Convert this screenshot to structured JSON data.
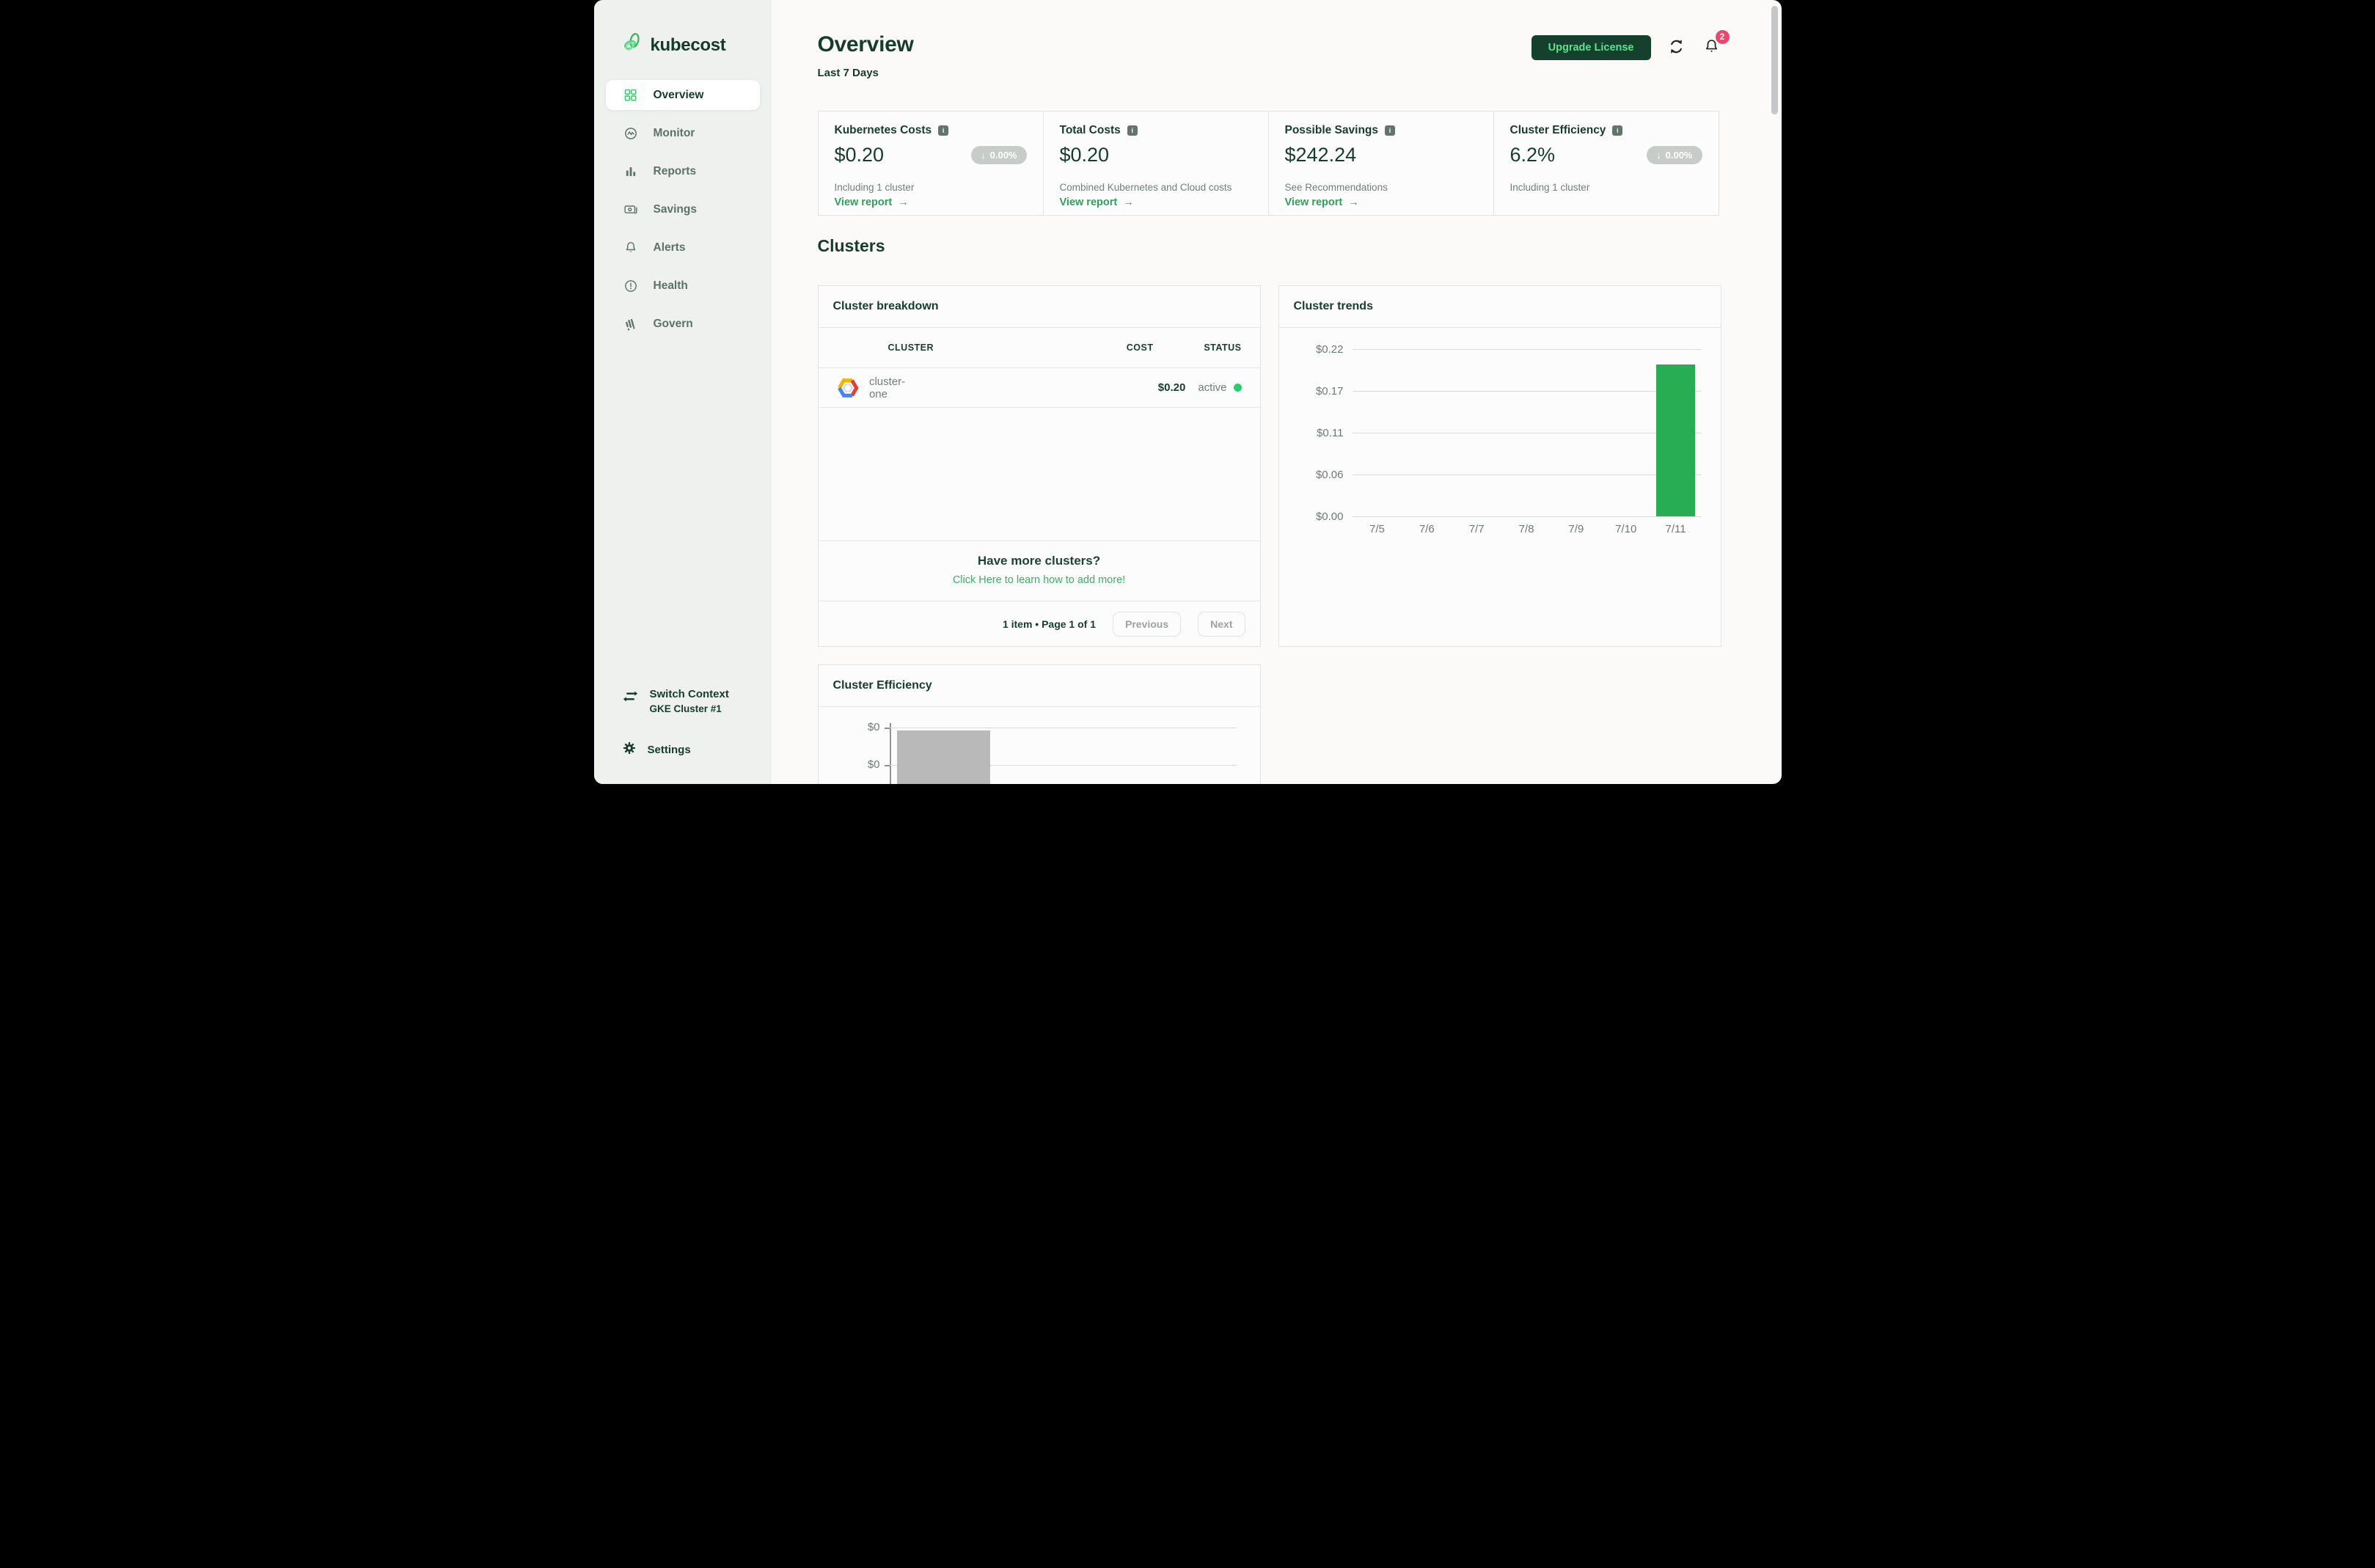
{
  "sidebar": {
    "logo_text": "kubecost",
    "nav": [
      {
        "label": "Overview",
        "active": true
      },
      {
        "label": "Monitor",
        "active": false
      },
      {
        "label": "Reports",
        "active": false
      },
      {
        "label": "Savings",
        "active": false
      },
      {
        "label": "Alerts",
        "active": false
      },
      {
        "label": "Health",
        "active": false
      },
      {
        "label": "Govern",
        "active": false
      }
    ],
    "switch_context": {
      "title": "Switch Context",
      "subtitle": "GKE Cluster #1"
    },
    "settings_label": "Settings"
  },
  "header": {
    "title": "Overview",
    "subtitle": "Last 7 Days",
    "upgrade_button": "Upgrade License",
    "notification_count": "2"
  },
  "stat_cards": [
    {
      "title": "Kubernetes Costs",
      "value": "$0.20",
      "badge": "0.00%",
      "description": "Including 1 cluster",
      "link": "View report"
    },
    {
      "title": "Total Costs",
      "value": "$0.20",
      "description": "Combined Kubernetes and Cloud costs",
      "link": "View report"
    },
    {
      "title": "Possible Savings",
      "value": "$242.24",
      "description": "See Recommendations",
      "link": "View report"
    },
    {
      "title": "Cluster Efficiency",
      "value": "6.2%",
      "badge": "0.00%",
      "description": "Including 1 cluster"
    }
  ],
  "clusters_section": {
    "heading": "Clusters",
    "breakdown": {
      "title": "Cluster breakdown",
      "columns": {
        "cluster": "CLUSTER",
        "cost": "COST",
        "status": "STATUS"
      },
      "rows": [
        {
          "provider": "gcp",
          "cluster": "cluster-one",
          "cost": "$0.20",
          "status": "active"
        }
      ],
      "cta_title": "Have more clusters?",
      "cta_link": "Click Here to learn how to add more!",
      "pagination": {
        "summary": "1 item • Page 1 of 1",
        "previous": "Previous",
        "next": "Next"
      }
    },
    "trends_title": "Cluster trends",
    "efficiency_title": "Cluster Efficiency"
  },
  "chart_data": [
    {
      "type": "bar",
      "title": "Cluster trends",
      "categories": [
        "7/5",
        "7/6",
        "7/7",
        "7/8",
        "7/9",
        "7/10",
        "7/11"
      ],
      "values": [
        0,
        0,
        0,
        0,
        0,
        0,
        0.2
      ],
      "ylabel_ticks": [
        "$0.00",
        "$0.06",
        "$0.11",
        "$0.17",
        "$0.22"
      ],
      "ylim": [
        0,
        0.22
      ],
      "bar_color": "#27ae55",
      "grid": true,
      "legend": "none"
    },
    {
      "type": "bar",
      "title": "Cluster Efficiency",
      "yticks_visible": [
        "$0",
        "$0"
      ],
      "visible_bars": 1,
      "bar_color": "#b9b9b9",
      "partially_visible": true
    }
  ],
  "colors": {
    "brand_dark_green": "#153c2e",
    "accent_green": "#2da15c",
    "bar_green": "#27ae55",
    "sidebar_bg": "#eef1ee",
    "badge_gray": "#c8ccc9",
    "notification_red": "#e9486f",
    "status_active_green": "#2dcb6f"
  }
}
